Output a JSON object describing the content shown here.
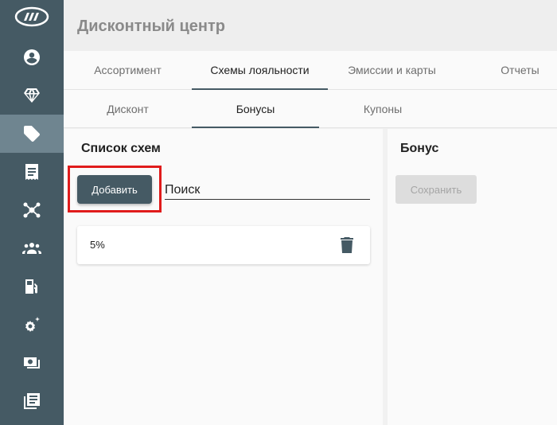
{
  "header": {
    "title": "Дисконтный центр"
  },
  "sidebar": {
    "logo_icon": "logo-icon",
    "items": [
      {
        "icon": "account-icon",
        "active": false
      },
      {
        "icon": "diamond-icon",
        "active": false
      },
      {
        "icon": "tags-icon",
        "active": true
      },
      {
        "icon": "receipt-icon",
        "active": false
      },
      {
        "icon": "network-icon",
        "active": false
      },
      {
        "icon": "group-icon",
        "active": false
      },
      {
        "icon": "fuel-station-icon",
        "active": false
      },
      {
        "icon": "settings-sparkle-icon",
        "active": false
      },
      {
        "icon": "cash-icon",
        "active": false
      },
      {
        "icon": "library-books-icon",
        "active": false
      }
    ]
  },
  "tabs": {
    "primary": [
      "Ассортимент",
      "Схемы лояльности",
      "Эмиссии и карты",
      "Отчеты"
    ],
    "primary_active": "Схемы лояльности",
    "secondary": [
      "Дисконт",
      "Бонусы",
      "Купоны"
    ],
    "secondary_active": "Бонусы"
  },
  "left_panel": {
    "title": "Список схем",
    "add_label": "Добавить",
    "search_value": "Поиск",
    "items": [
      {
        "label": "5%"
      }
    ]
  },
  "right_panel": {
    "title": "Бонус",
    "save_label": "Сохранить"
  },
  "colors": {
    "sidebar": "#455a64",
    "sidebar_active": "#6f8590",
    "primary_button": "#455a64",
    "highlight_box": "#e01b1b",
    "disabled_button": "#dddddd"
  }
}
